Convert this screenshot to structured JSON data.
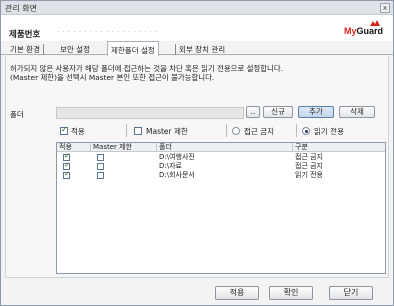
{
  "window": {
    "title": "관리 화면",
    "close_glyph": "x"
  },
  "header": {
    "serial_label": "제품번호",
    "serial_value": "· · · · · · · · · · · · · · · · · · ·",
    "logo": {
      "prefix": "My",
      "suffix": "Guard",
      "prefix_color": "#d9261c"
    }
  },
  "tabs": [
    {
      "label": "기본 환경",
      "active": false
    },
    {
      "label": "보안 설정",
      "active": false
    },
    {
      "label": "제한폴더 설정",
      "active": true
    },
    {
      "label": "외부 장치 관리",
      "active": false
    }
  ],
  "description": {
    "line1": "허가되지 않은 사용자가 해당 폴더에 접근하는 것을 차단 혹은 읽기 전용으로 설정합니다.",
    "line2": "(Master 제한)을 선택시 Master 본인 또한 접근이 불가능합니다."
  },
  "folder": {
    "label": "폴더",
    "path_value": "",
    "browse_label": "..",
    "new_label": "신규",
    "add_label": "추가",
    "delete_label": "삭제"
  },
  "options": {
    "apply_label": "적용",
    "apply_checked": true,
    "master_label": "Master 제한",
    "master_checked": false,
    "block_label": "접근 금지",
    "block_selected": false,
    "readonly_label": "읽기 전용",
    "readonly_selected": true
  },
  "table": {
    "columns": [
      "적용",
      "Master 제한",
      "폴더",
      "구분"
    ],
    "rows": [
      {
        "apply": true,
        "master": false,
        "folder": "D:\\여행사진",
        "type": "접근 금지"
      },
      {
        "apply": true,
        "master": false,
        "folder": "D:\\자료",
        "type": "접근 금지"
      },
      {
        "apply": true,
        "master": false,
        "folder": "D:\\회사문서",
        "type": "읽기 전용"
      }
    ]
  },
  "footer": {
    "apply_label": "적용",
    "ok_label": "확인",
    "close_label": "닫기"
  }
}
